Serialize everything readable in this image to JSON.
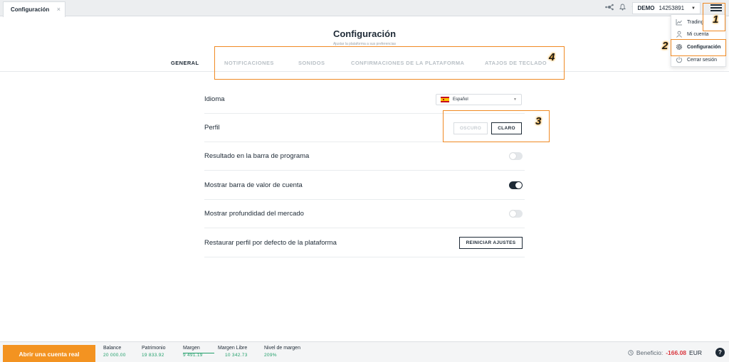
{
  "tab": {
    "label": "Configuración",
    "close": "×"
  },
  "account": {
    "mode": "DEMO",
    "number": "14253891"
  },
  "menu": {
    "items": [
      {
        "label": "Trading",
        "icon": "chart-line-icon"
      },
      {
        "label": "Mi cuenta",
        "icon": "user-icon"
      },
      {
        "label": "Configuración",
        "icon": "gear-icon"
      },
      {
        "label": "Cerrar sesión",
        "icon": "power-icon"
      }
    ]
  },
  "header": {
    "title": "Configuración",
    "subtitle": "Ajustar la plataforma a sus preferencias"
  },
  "tabs": [
    {
      "label": "GENERAL",
      "active": true
    },
    {
      "label": "NOTIFICACIONES",
      "active": false
    },
    {
      "label": "SONIDOS",
      "active": false
    },
    {
      "label": "CONFIRMACIONES DE LA PLATAFORMA",
      "active": false
    },
    {
      "label": "ATAJOS DE TECLADO",
      "active": false
    }
  ],
  "settings": {
    "language": {
      "label": "Idioma",
      "value": "Español"
    },
    "profile": {
      "label": "Perfil",
      "dark": "OSCURO",
      "light": "CLARO"
    },
    "result_bar": {
      "label": "Resultado en la barra de programa",
      "on": false
    },
    "account_value_bar": {
      "label": "Mostrar barra de valor de cuenta",
      "on": true
    },
    "market_depth": {
      "label": "Mostrar profundidad del mercado",
      "on": false
    },
    "restore": {
      "label": "Restaurar perfil por defecto de la plataforma",
      "button": "REINICIAR AJUSTES"
    }
  },
  "annotations": [
    "1",
    "2",
    "3",
    "4"
  ],
  "footer": {
    "open_account": "Abrir una cuenta real",
    "stats": [
      {
        "label": "Balance",
        "value": "20 000.00"
      },
      {
        "label": "Patrimonio",
        "value": "19 833.92"
      },
      {
        "label": "Margen",
        "value": "9 491.19"
      },
      {
        "label": "Margen Libre",
        "value": "10 342.73"
      },
      {
        "label": "Nivel de margen",
        "value": "209%"
      }
    ],
    "profit_label": "Beneficio:",
    "profit_value": "-166.08",
    "currency": "EUR",
    "help": "?"
  },
  "colors": {
    "accent": "#f39321",
    "positive": "#22a06b",
    "negative": "#d9363e",
    "dark": "#1e2a36"
  }
}
